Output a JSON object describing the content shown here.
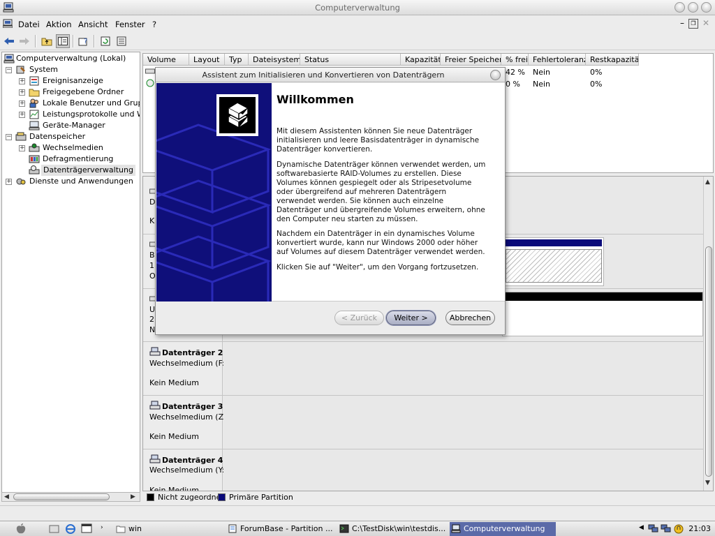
{
  "window": {
    "title": "Computerverwaltung"
  },
  "menu": [
    "Datei",
    "Aktion",
    "Ansicht",
    "Fenster",
    "?"
  ],
  "tree": {
    "root": "Computerverwaltung (Lokal)",
    "system": "System",
    "system_items": [
      "Ereignisanzeige",
      "Freigegebene Ordner",
      "Lokale Benutzer und Gruppe",
      "Leistungsprotokolle und War",
      "Geräte-Manager"
    ],
    "storage": "Datenspeicher",
    "storage_items": [
      "Wechselmedien",
      "Defragmentierung",
      "Datenträgerverwaltung"
    ],
    "services": "Dienste und Anwendungen"
  },
  "columns": [
    "Volume",
    "Layout",
    "Typ",
    "Dateisystem",
    "Status",
    "Kapazität",
    "Freier Speicher",
    "% frei",
    "Fehlertoleranz",
    "Restkapazität"
  ],
  "rows": [
    {
      "pct": "42 %",
      "ft": "Nein",
      "rest": "0%"
    },
    {
      "pct": "0 %",
      "ft": "Nein",
      "rest": "0%"
    }
  ],
  "disk_partial": [
    {
      "l1": "D",
      "l2": "",
      "l3": "K"
    },
    {
      "l1": "B",
      "l2": "1",
      "l3": "O"
    },
    {
      "l1": "U",
      "l2": "2",
      "l3": "N"
    }
  ],
  "disks": [
    {
      "title": "Datenträger 2",
      "type": "Wechselmedium (F:)",
      "status": "Kein Medium"
    },
    {
      "title": "Datenträger 3",
      "type": "Wechselmedium (Z:)",
      "status": "Kein Medium"
    },
    {
      "title": "Datenträger 4",
      "type": "Wechselmedium (Y:)",
      "status": "Kein Medium"
    }
  ],
  "legend": {
    "unallocated": "Nicht zugeordnet",
    "primary": "Primäre Partition"
  },
  "colors": {
    "unallocated": "#000000",
    "primary": "#0a0a7a",
    "banner": "#0f0f7a"
  },
  "dialog": {
    "title": "Assistent zum Initialisieren und Konvertieren von Datenträgern",
    "heading": "Willkommen",
    "p1": "Mit diesem Assistenten können Sie neue Datenträger initialisieren und leere Basisdatenträger in dynamische Datenträger konvertieren.",
    "p2": "Dynamische Datenträger können verwendet werden, um softwarebasierte RAID-Volumes zu erstellen. Diese Volumes können gespiegelt oder als Stripesetvolume oder übergreifend auf mehreren Datenträgern verwendet werden. Sie können auch einzelne Datenträger und übergreifende Volumes erweitern, ohne den Computer neu starten zu müssen.",
    "p3": "Nachdem ein Datenträger in ein dynamisches Volume konvertiert wurde, kann nur Windows 2000 oder höher auf Volumes auf diesem Datenträger verwendet werden.",
    "p4": "Klicken Sie auf \"Weiter\", um den Vorgang fortzusetzen.",
    "back": "< Zurück",
    "next": "Weiter >",
    "cancel": "Abbrechen"
  },
  "taskbar": {
    "folder": "win",
    "tasks": [
      "ForumBase - Partition ...",
      "C:\\TestDisk\\win\\testdis...",
      "Computerverwaltung"
    ],
    "clock": "21:03"
  }
}
